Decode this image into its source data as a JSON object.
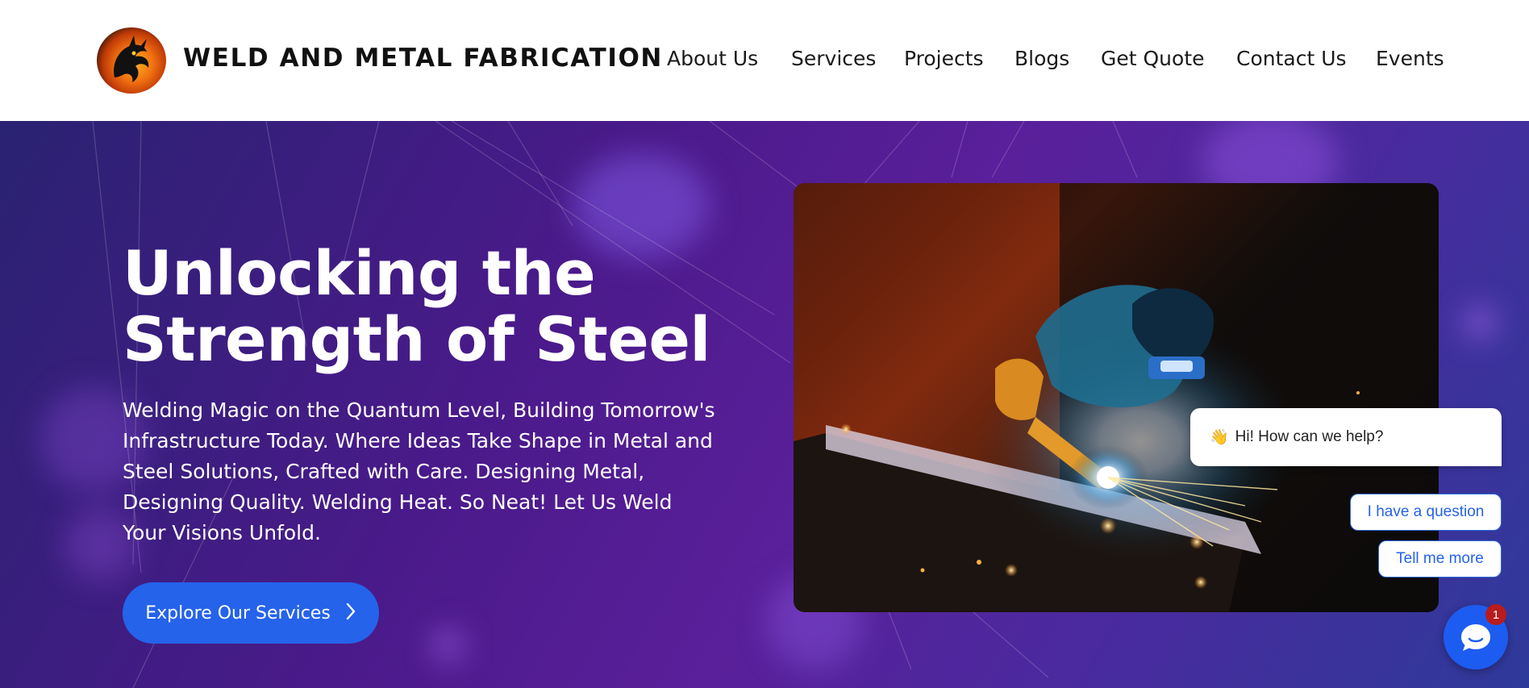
{
  "header": {
    "brand": "WELD AND METAL FABRICATION",
    "nav": [
      "About Us",
      "Services",
      "Projects",
      "Blogs",
      "Get Quote",
      "Contact Us",
      "Events"
    ]
  },
  "hero": {
    "title": "Unlocking the Strength of Steel",
    "text": "Welding Magic on the Quantum Level, Building Tomorrow's Infrastructure Today. Where Ideas Take Shape in Metal and Steel Solutions, Crafted with Care. Designing Metal, Designing Quality. Welding Heat. So Neat! Let Us Weld Your Visions Unfold.",
    "cta_label": "Explore Our Services"
  },
  "chat": {
    "greeting_emoji": "👋",
    "greeting": "Hi! How can we help?",
    "options": [
      "I have a question",
      "Tell me more"
    ],
    "badge_count": "1"
  },
  "colors": {
    "accent": "#2563eb",
    "hero_gradient_start": "#2a2272",
    "hero_gradient_mid": "#5a1f9a",
    "badge": "#b91c1c"
  },
  "icons": {
    "logo": "dragon-logo-icon",
    "cta": "chevron-right-icon",
    "chat_launcher": "chat-bubble-icon"
  }
}
